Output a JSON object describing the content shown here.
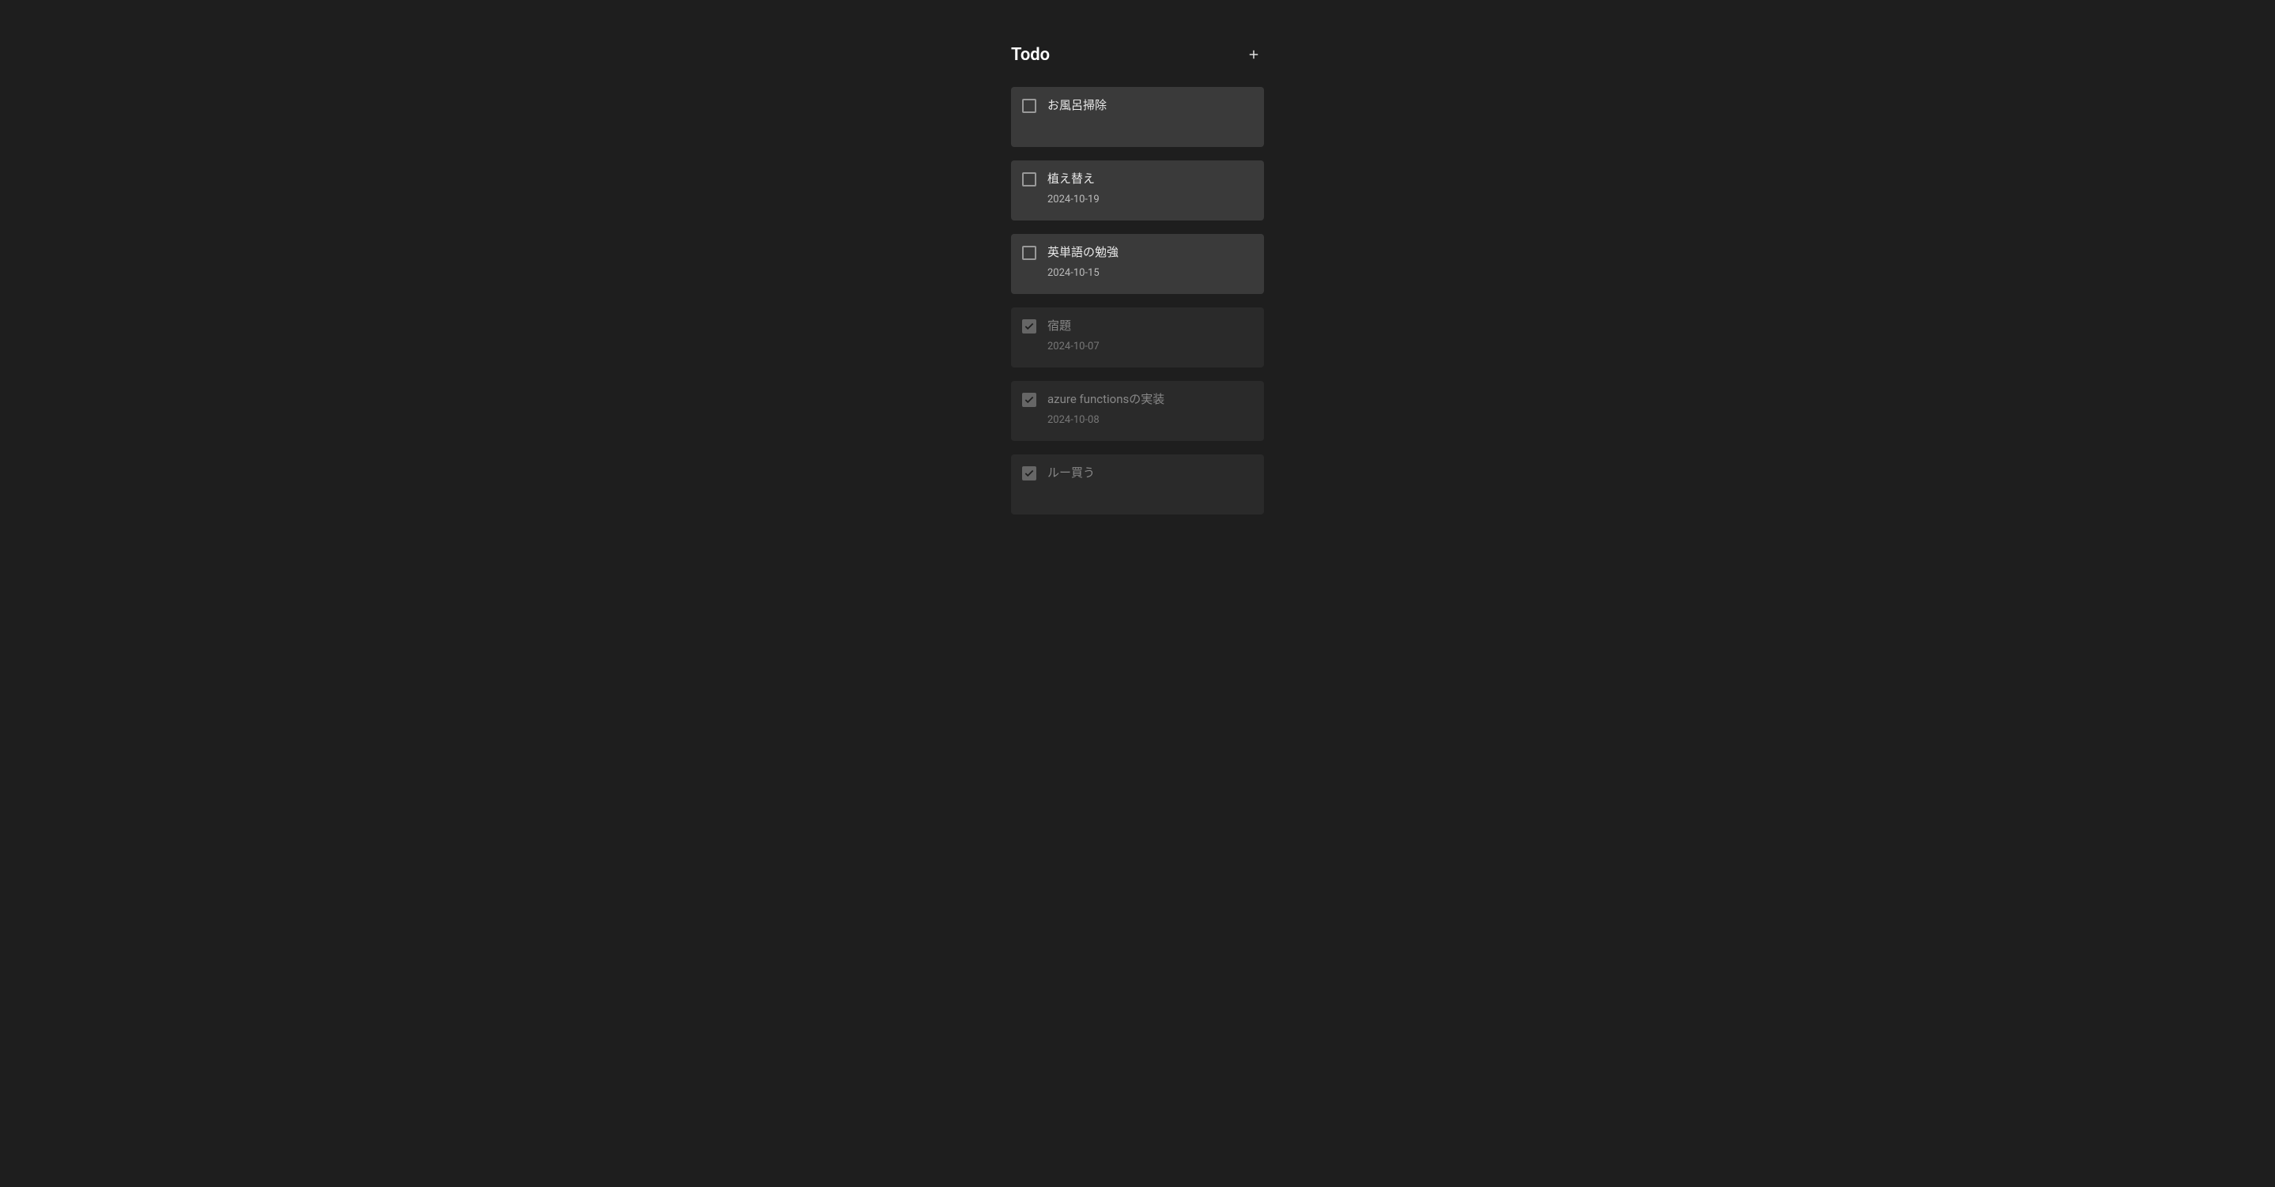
{
  "header": {
    "title": "Todo"
  },
  "todos": [
    {
      "title": "お風呂掃除",
      "date": "",
      "completed": false
    },
    {
      "title": "植え替え",
      "date": "2024-10-19",
      "completed": false
    },
    {
      "title": "英単語の勉強",
      "date": "2024-10-15",
      "completed": false
    },
    {
      "title": "宿題",
      "date": "2024-10-07",
      "completed": true
    },
    {
      "title": "azure functionsの実装",
      "date": "2024-10-08",
      "completed": true
    },
    {
      "title": "ルー買う",
      "date": "",
      "completed": true
    }
  ]
}
